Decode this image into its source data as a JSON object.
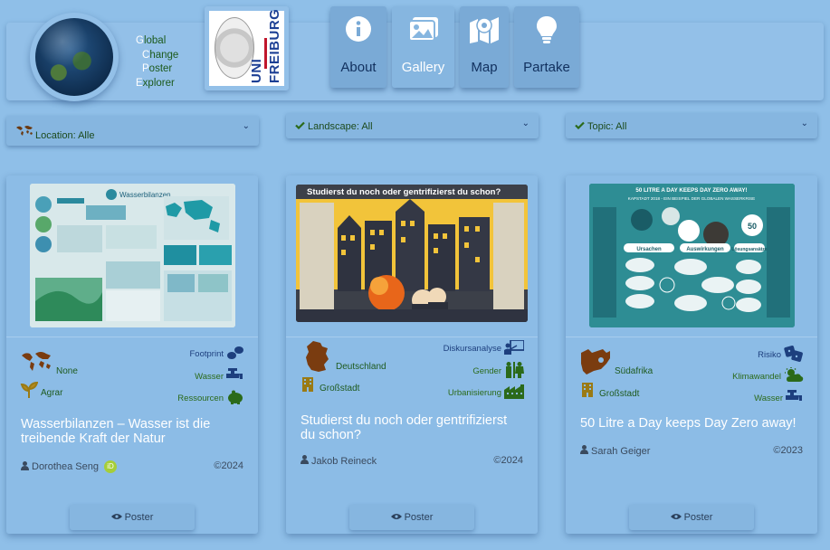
{
  "brand": {
    "lines": [
      {
        "cap": "G",
        "rest": "lobal"
      },
      {
        "cap": "C",
        "rest": "hange"
      },
      {
        "cap": "P",
        "rest": "oster"
      },
      {
        "cap": "E",
        "rest": "xplorer"
      }
    ],
    "uni_logo_text": "UNI FREIBURG"
  },
  "nav": [
    {
      "label": "About",
      "icon": "info-circle-icon"
    },
    {
      "label": "Gallery",
      "icon": "images-icon"
    },
    {
      "label": "Map",
      "icon": "map-marker-icon"
    },
    {
      "label": "Partake",
      "icon": "lightbulb-icon"
    }
  ],
  "filters": [
    {
      "label": "Location: Alle",
      "icon": "world-map-icon"
    },
    {
      "label": "Landscape: All",
      "icon": "check-icon"
    },
    {
      "label": "Topic: All",
      "icon": "check-icon"
    }
  ],
  "cards": [
    {
      "title": "Wasserbilanzen – Wasser ist die treibende Kraft der Natur",
      "location": "None",
      "landscape": "Agrar",
      "topics": [
        "Footprint",
        "Wasser",
        "Ressourcen"
      ],
      "author": "Dorothea Seng",
      "orcid": "iD",
      "year": "©2024",
      "button": "Poster",
      "poster_heading": "Wasserbilanzen"
    },
    {
      "title": "Studierst du noch oder gentrifizierst du schon?",
      "location": "Deutschland",
      "landscape": "Großstadt",
      "topics": [
        "Diskursanalyse",
        "Gender",
        "Urbanisierung"
      ],
      "author": "Jakob Reineck",
      "year": "©2024",
      "button": "Poster",
      "poster_heading": "Studierst du noch oder gentrifizierst du schon?"
    },
    {
      "title": "50 Litre a Day keeps Day Zero away!",
      "location": "Südafrika",
      "landscape": "Großstadt",
      "topics": [
        "Risiko",
        "Klimawandel",
        "Wasser"
      ],
      "author": "Sarah Geiger",
      "year": "©2023",
      "button": "Poster",
      "poster_heading": "50 LITRE A DAY KEEPS DAY ZERO AWAY!",
      "poster_subheading": "KAPSTADT 2018 - EIN BEISPIEL DER GLOBALEN WASSERKRISE",
      "poster_sections": [
        "Ursachen",
        "Auswirkungen",
        "Lösungsansätze"
      ]
    }
  ]
}
